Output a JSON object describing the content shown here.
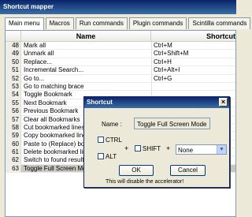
{
  "window": {
    "title": "Shortcut mapper"
  },
  "tabs": [
    {
      "label": "Main menu",
      "active": true
    },
    {
      "label": "Macros"
    },
    {
      "label": "Run commands"
    },
    {
      "label": "Plugin commands"
    },
    {
      "label": "Scintilla commands"
    }
  ],
  "table": {
    "headers": {
      "name": "Name",
      "shortcut": "Shortcut"
    },
    "rows": [
      {
        "num": "48",
        "name": "Mark all",
        "key": "Ctrl+M"
      },
      {
        "num": "49",
        "name": "Unmark all",
        "key": "Ctrl+Shift+M"
      },
      {
        "num": "50",
        "name": "Replace...",
        "key": "Ctrl+H"
      },
      {
        "num": "51",
        "name": "Incremental Search...",
        "key": "Ctrl+Alt+I"
      },
      {
        "num": "52",
        "name": "Go to...",
        "key": "Ctrl+G"
      },
      {
        "num": "53",
        "name": "Go to matching brace",
        "key": ""
      },
      {
        "num": "54",
        "name": "Toggle Bookmark",
        "key": ""
      },
      {
        "num": "55",
        "name": "Next Bookmark",
        "key": ""
      },
      {
        "num": "56",
        "name": "Previous Bookmark",
        "key": ""
      },
      {
        "num": "57",
        "name": "Clear all Bookmarks",
        "key": ""
      },
      {
        "num": "58",
        "name": "Cut bookmarked lines",
        "key": ""
      },
      {
        "num": "59",
        "name": "Copy bookmarked lines",
        "key": ""
      },
      {
        "num": "60",
        "name": "Paste to (Replace) bookmarked lines",
        "key": ""
      },
      {
        "num": "61",
        "name": "Delete bookmarked lines",
        "key": ""
      },
      {
        "num": "62",
        "name": "Switch to found results window",
        "key": "F7"
      },
      {
        "num": "63",
        "name": "Toggle Full Screen Mode",
        "key": "F11",
        "selected": true
      }
    ]
  },
  "dialog": {
    "title": "Shortcut",
    "close_glyph": "×",
    "name_label": "Name :",
    "name_value": "Toggle Full Screen Mode",
    "ctrl_label": "CTRL",
    "alt_label": "ALT",
    "shift_label": "SHIFT",
    "plus": "+",
    "key_select": "None",
    "ok_label": "OK",
    "cancel_label": "Cancel",
    "warning": "This will disable the accelerator!"
  }
}
